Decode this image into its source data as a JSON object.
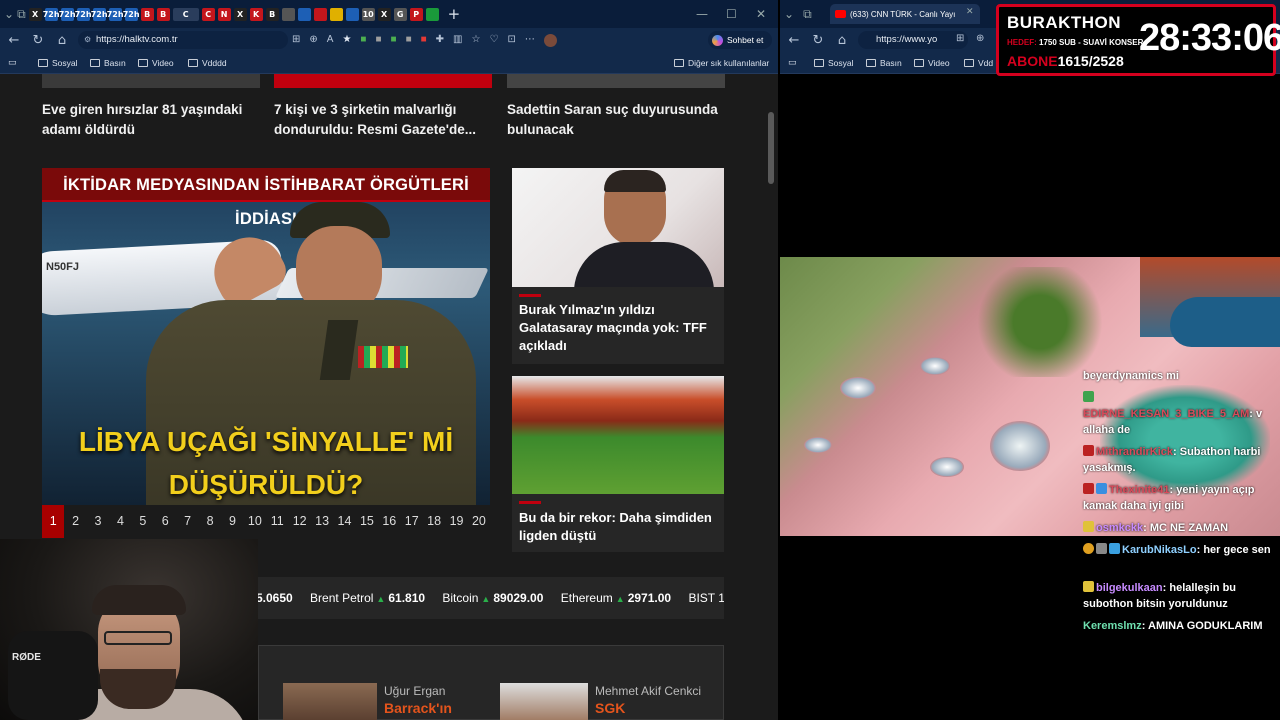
{
  "left_browser": {
    "tab_bar": {
      "tabs": [
        "X",
        "72h",
        "72h",
        "72h",
        "72h",
        "72h",
        "72h",
        "B",
        "B",
        "C",
        "C",
        "N",
        "X",
        "K",
        "B",
        "10",
        "X",
        "G",
        "P"
      ],
      "new_tab": "+",
      "minimize": "—",
      "restore": "☐",
      "close": "✕"
    },
    "address_bar": {
      "url": "https://halktv.com.tr",
      "copilot_label": "Sohbet et"
    },
    "bookmarks": {
      "items": [
        "Sosyal",
        "Basın",
        "Video",
        "Vdddd"
      ],
      "other": "Diğer sık kullanılanlar"
    },
    "page": {
      "top_headlines": [
        "Eve giren hırsızlar 81 yaşındaki adamı öldürdü",
        "7 kişi ve 3 şirketin malvarlığı donduruldu: Resmi Gazete'de...",
        "Sadettin Saran suç duyurusunda bulunacak"
      ],
      "slider": {
        "banner": "İKTİDAR MEDYASINDAN İSTİHBARAT ÖRGÜTLERİ İDDİASI",
        "headline_line1": "LİBYA UÇAĞI 'SİNYALLE' Mİ",
        "headline_line2": "DÜŞÜRÜLDÜ?",
        "plane_reg": "N50FJ",
        "pages": [
          "1",
          "2",
          "3",
          "4",
          "5",
          "6",
          "7",
          "8",
          "9",
          "10",
          "11",
          "12",
          "13",
          "14",
          "15",
          "16",
          "17",
          "18",
          "19",
          "20"
        ],
        "active_page": "1"
      },
      "side_cards": [
        "Burak Yılmaz'ın yıldızı Galatasaray maçında yok: TFF açıkladı",
        "Bu da bir rekor: Daha şimdiden ligden düştü"
      ],
      "ticker": [
        {
          "name": "",
          "value": "5.0650"
        },
        {
          "name": "Brent Petrol",
          "value": "61.810"
        },
        {
          "name": "Bitcoin",
          "value": "89029.00"
        },
        {
          "name": "Ethereum",
          "value": "2971.00"
        },
        {
          "name": "BIST 1",
          "value": ""
        }
      ],
      "authors": [
        {
          "name": "Uğur Ergan",
          "title": "Barrack'ın"
        },
        {
          "name": "Mehmet Akif Cenkci",
          "title": "SGK"
        }
      ]
    }
  },
  "right_browser": {
    "tabs": [
      "(633) CNN TÜRK - Canlı Yayı"
    ],
    "tab_close": "✕",
    "url": "https://www.yo",
    "bookmarks": [
      "Sosyal",
      "Basın",
      "Video",
      "Vdd"
    ]
  },
  "overlay": {
    "title": "BURAKTHON",
    "hedef_label": "HEDEF:",
    "hedef_value": "1750 SUB - SUAVİ KONSER",
    "abone_label": "ABONE",
    "abone_value": "1615/2528",
    "timer": "28:33:06"
  },
  "chat": [
    {
      "user": "",
      "text": "beyerdynamics mi",
      "color": "#ffffff"
    },
    {
      "user": "EDIRNE_KESAN_3_BIKE_5_AM",
      "text": "v allaha de",
      "color": "#d94a5a"
    },
    {
      "user": "MithrandirKick",
      "text": "Subathon harbi yasakmış.",
      "color": "#d94a5a"
    },
    {
      "user": "Thexinite41",
      "text": "yeni yayın açıp kamak daha iyi gibi",
      "color": "#d94a5a"
    },
    {
      "user": "osmkckk",
      "text": "MC NE ZAMAN",
      "color": "#c78bff"
    },
    {
      "user": "KarubNikasLo",
      "text": "her gece sen",
      "color": "#8fd0ff"
    },
    {
      "user": "bilgekulkaan",
      "text": "helalleşin bu subothon bitsin yoruldunuz",
      "color": "#c78bff"
    },
    {
      "user": "Keremslmz",
      "text": "AMINA GODUKLARIM",
      "color": "#6fe0b0"
    }
  ],
  "webcam": {
    "mic_brand": "RØDE"
  },
  "colors": {
    "brand_red": "#c0000e",
    "tab_bg": "#0a1d3a",
    "up_arrow": "#2ab04a",
    "overlay_border": "#d4001e"
  }
}
